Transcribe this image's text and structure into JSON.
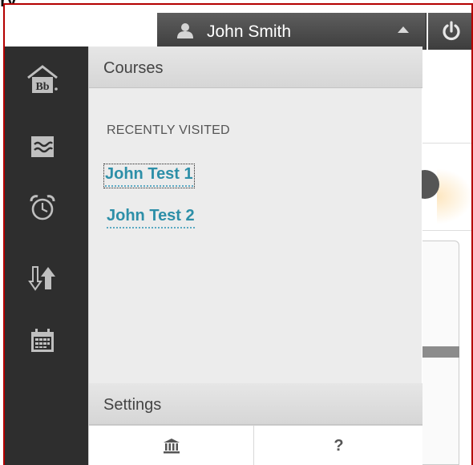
{
  "top_fragment": "ry",
  "header": {
    "user_name": "John Smith",
    "user_icon": "person-icon",
    "caret_icon": "caret-up-icon",
    "power_icon": "power-icon"
  },
  "rail": {
    "items": [
      {
        "name": "institution-home",
        "icon": "bb-home-icon"
      },
      {
        "name": "activity-stream",
        "icon": "stream-icon"
      },
      {
        "name": "calendar-due",
        "icon": "alarm-clock-icon"
      },
      {
        "name": "grades",
        "icon": "grades-arrows-icon"
      },
      {
        "name": "calendar",
        "icon": "calendar-icon"
      }
    ]
  },
  "panel": {
    "courses_title": "Courses",
    "recently_visited_label": "RECENTLY VISITED",
    "courses": [
      {
        "label": "John Test 1"
      },
      {
        "label": "John Test 2"
      }
    ],
    "settings_title": "Settings",
    "settings_items": [
      {
        "icon": "institution-icon"
      },
      {
        "label": "?",
        "icon": "help-icon"
      }
    ]
  },
  "colors": {
    "rail_bg": "#2e2e2e",
    "panel_bg": "#ececec",
    "link": "#2d8fa8",
    "topbar": "#4a4a4a",
    "frame": "#b40000"
  }
}
